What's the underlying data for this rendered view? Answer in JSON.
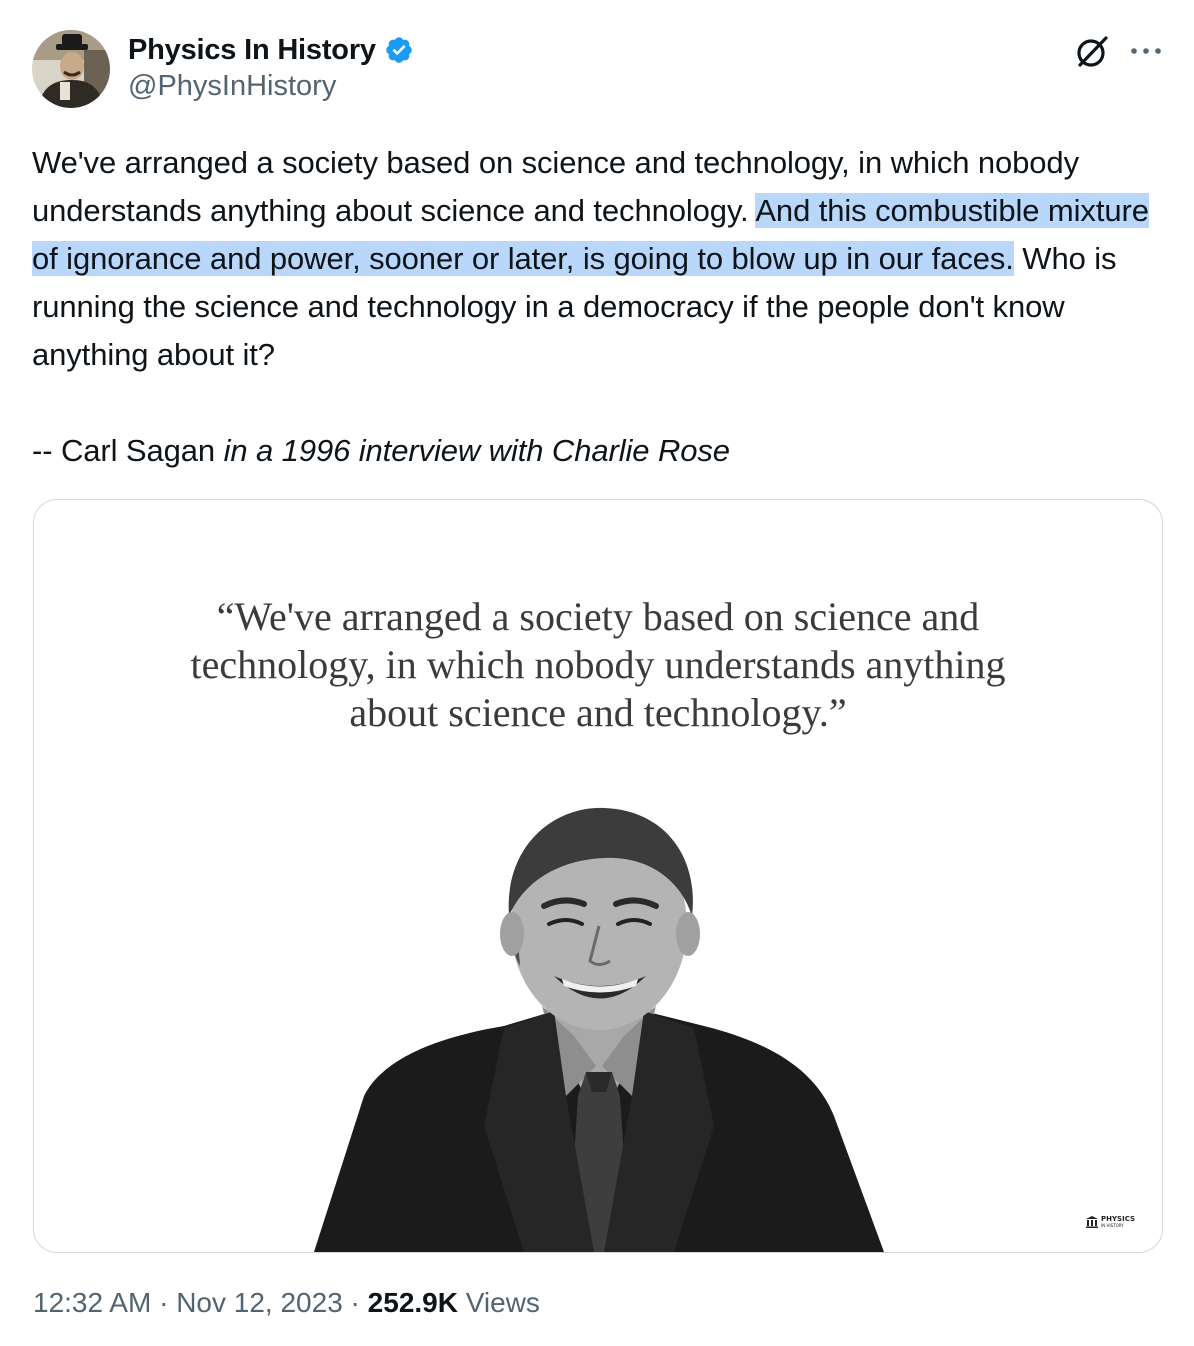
{
  "author": {
    "display_name": "Physics In History",
    "handle": "@PhysInHistory",
    "verified": true,
    "verified_color": "#1d9bf0",
    "avatar_icon": "avatar-photo"
  },
  "header_actions": {
    "grok_icon": "grok-icon",
    "more_icon": "more-icon"
  },
  "tweet": {
    "part1": "We've arranged a society based on science and technology, in which nobody understands anything about science and technology. ",
    "highlighted": "And this combustible mixture of ignorance and power, sooner or later, is going to blow up in our faces.",
    "part2": " Who is running the science and technology in a democracy if the people don't know anything about it?",
    "attribution": "-- Carl Sagan ",
    "attribution_italic": "in a 1996 interview with Charlie Rose",
    "highlight_color": "#b9d7fb"
  },
  "media": {
    "quote_lines": [
      "“We've arranged a society based on science and",
      "technology, in which nobody understands anything",
      "about science and technology.”"
    ],
    "logo_text_1": "PHYSICS",
    "logo_text_2": "IN HISTORY"
  },
  "meta": {
    "time": "12:32 AM",
    "separator": " · ",
    "date": "Nov 12, 2023",
    "views_count": "252.9K",
    "views_label": " Views"
  }
}
